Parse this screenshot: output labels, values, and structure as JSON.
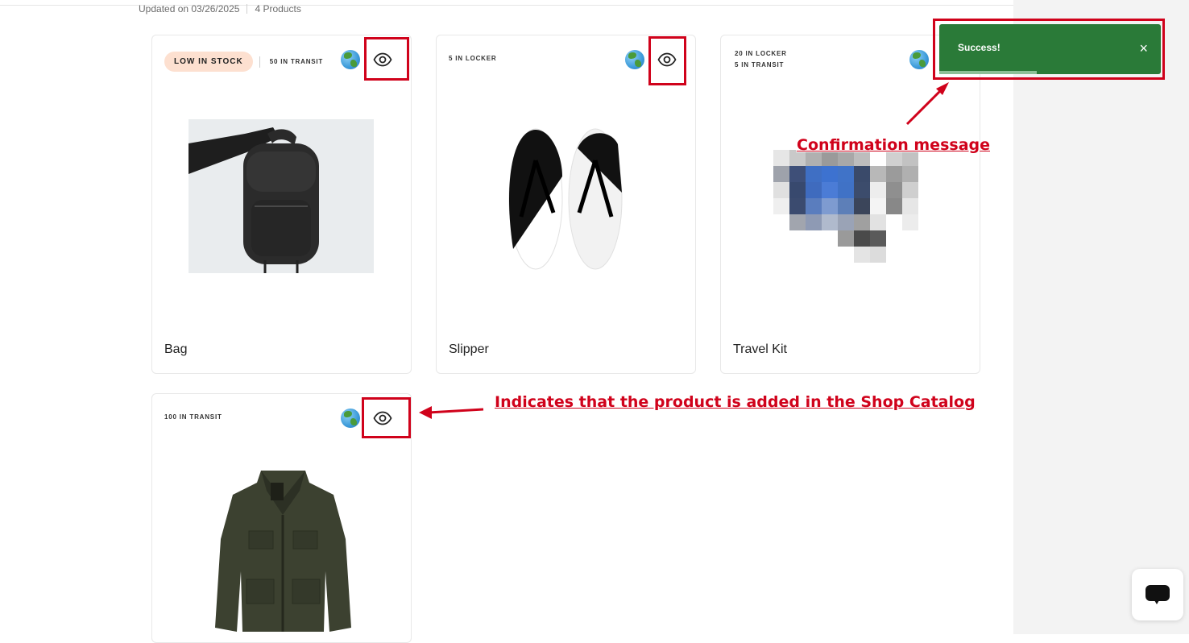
{
  "header": {
    "updated_text": "Updated on 03/26/2025",
    "products_count": "4 Products"
  },
  "products": [
    {
      "name": "Bag",
      "badge": "LOW IN STOCK",
      "stock": [
        "50 IN TRANSIT"
      ]
    },
    {
      "name": "Slipper",
      "badge": "",
      "stock": [
        "5 IN LOCKER"
      ]
    },
    {
      "name": "Travel Kit",
      "badge": "",
      "stock": [
        "20 IN LOCKER",
        "5 IN TRANSIT"
      ]
    },
    {
      "name": "",
      "badge": "",
      "stock": [
        "100 IN TRANSIT"
      ]
    }
  ],
  "toast": {
    "message": "Success!",
    "close_glyph": "×",
    "progress": 0.44,
    "color": "#2a7a38"
  },
  "annotations": {
    "confirmation": "Confirmation message",
    "catalog": "Indicates that the product is added in the Shop Catalog",
    "color": "#d0021b"
  },
  "icons": [
    "globe-icon",
    "eye-icon",
    "close-icon",
    "chat-icon"
  ]
}
